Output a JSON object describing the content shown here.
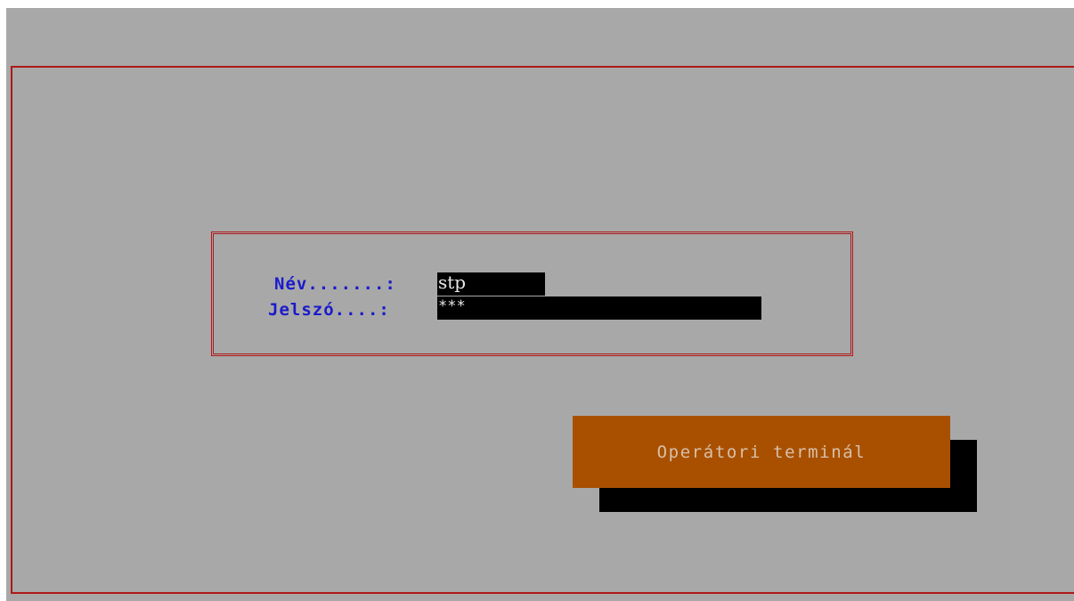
{
  "login": {
    "name_label": "Név.......:",
    "name_value": "stp",
    "password_label": "Jelszó....:",
    "password_value": "***"
  },
  "terminal_button": {
    "label": "Operátori terminál"
  },
  "colors": {
    "background": "#a8a8a8",
    "frame": "#b01818",
    "label": "#1a1acc",
    "input_bg": "#000000",
    "button_bg": "#a85000",
    "button_text": "#d8c0a8"
  }
}
